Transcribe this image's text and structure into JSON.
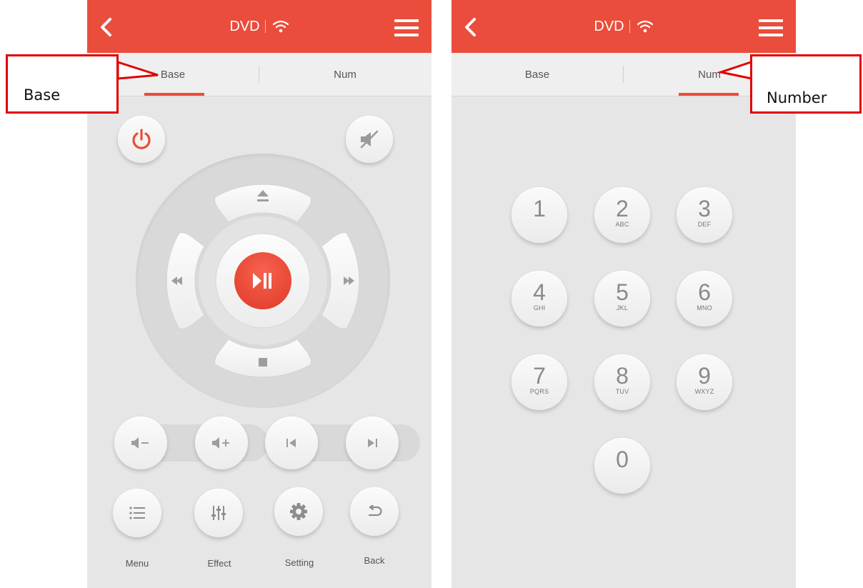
{
  "colors": {
    "accent": "#ea4d3b",
    "callout": "#e00000"
  },
  "screens": [
    {
      "header": {
        "title": "DVD"
      },
      "tabs": {
        "base": "Base",
        "num": "Num",
        "active": "base"
      },
      "controls": {
        "top": [
          "power-icon",
          "mute-icon"
        ],
        "dpad": [
          "eject-icon",
          "rewind-icon",
          "play-pause-icon",
          "fast-forward-icon",
          "stop-icon"
        ],
        "row": [
          "volume-down-icon",
          "volume-up-icon",
          "previous-track-icon",
          "next-track-icon"
        ]
      },
      "bottom": [
        {
          "label": "Menu",
          "icon": "list-icon"
        },
        {
          "label": "Effect",
          "icon": "equalizer-icon"
        },
        {
          "label": "Setting",
          "icon": "gear-icon"
        },
        {
          "label": "Back",
          "icon": "return-icon"
        }
      ]
    },
    {
      "header": {
        "title": "DVD"
      },
      "tabs": {
        "base": "Base",
        "num": "Num",
        "active": "num"
      },
      "keypad": [
        {
          "digit": "1",
          "letters": ""
        },
        {
          "digit": "2",
          "letters": "ABC"
        },
        {
          "digit": "3",
          "letters": "DEF"
        },
        {
          "digit": "4",
          "letters": "GHI"
        },
        {
          "digit": "5",
          "letters": "JKL"
        },
        {
          "digit": "6",
          "letters": "MNO"
        },
        {
          "digit": "7",
          "letters": "PQRS"
        },
        {
          "digit": "8",
          "letters": "TUV"
        },
        {
          "digit": "9",
          "letters": "WXYZ"
        },
        {
          "digit": "0",
          "letters": ""
        }
      ]
    }
  ],
  "annotations": {
    "left": "Base",
    "right": "Number"
  }
}
